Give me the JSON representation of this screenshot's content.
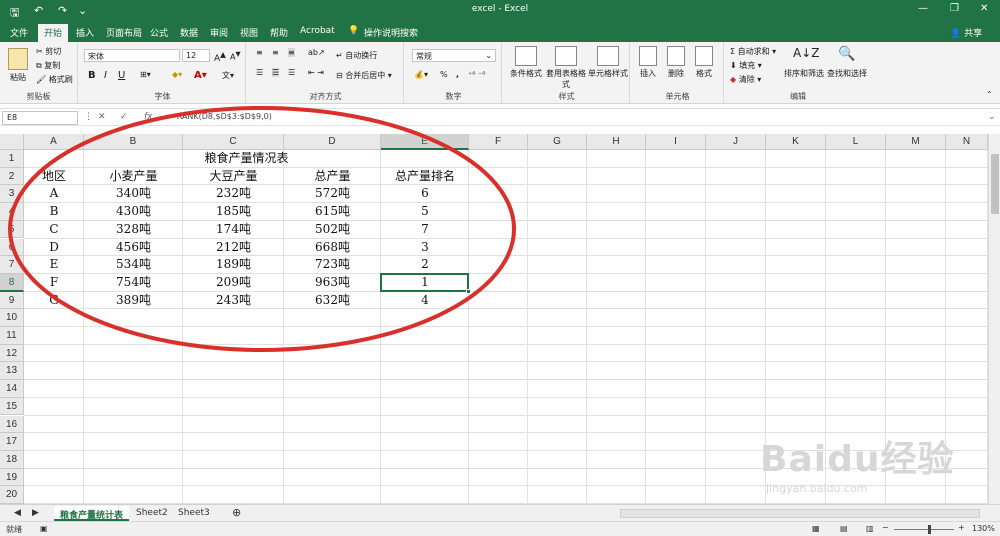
{
  "window": {
    "title": "excel - Excel",
    "account": "共享",
    "caption_min": "—",
    "caption_restore": "❐",
    "caption_close": "✕"
  },
  "ribbon_tabs": [
    "文件",
    "开始",
    "插入",
    "页面布局",
    "公式",
    "数据",
    "审阅",
    "视图",
    "帮助",
    "Acrobat",
    "操作说明搜索"
  ],
  "active_tab": "开始",
  "ribbon": {
    "clipboard": {
      "label": "剪贴板",
      "paste": "粘贴",
      "cut": "剪切",
      "copy": "复制",
      "format_painter": "格式刷"
    },
    "font": {
      "label": "字体",
      "font_name": "宋体",
      "font_size": "12",
      "bold": "B",
      "italic": "I",
      "underline": "U"
    },
    "alignment": {
      "label": "对齐方式",
      "wrap": "自动换行",
      "merge": "合并后居中"
    },
    "number": {
      "label": "数字",
      "format": "常规",
      "percent": "%",
      "comma": ","
    },
    "styles": {
      "label": "样式",
      "conditional": "条件格式",
      "table": "套用表格格式",
      "cell_styles": "单元格样式"
    },
    "cells": {
      "label": "单元格",
      "insert": "插入",
      "delete": "删除",
      "format": "格式"
    },
    "editing": {
      "label": "编辑",
      "autosum": "自动求和",
      "fill": "填充",
      "clear": "清除",
      "sort": "排序和筛选",
      "find": "查找和选择"
    }
  },
  "formula_bar": {
    "name_box": "E8",
    "formula": "=RANK(D8,$D$3:$D$9,0)"
  },
  "columns": [
    "A",
    "B",
    "C",
    "D",
    "E",
    "F",
    "G",
    "H",
    "I",
    "J",
    "K",
    "L",
    "M",
    "N"
  ],
  "rows": [
    "1",
    "2",
    "3",
    "4",
    "5",
    "6",
    "7",
    "8",
    "9",
    "10",
    "11",
    "12",
    "13",
    "14",
    "15",
    "16",
    "17",
    "18",
    "19",
    "20"
  ],
  "sheet": {
    "title": "粮食产量情况表",
    "headers": [
      "地区",
      "小麦产量",
      "大豆产量",
      "总产量",
      "总产量排名"
    ],
    "data": [
      [
        "A",
        "340吨",
        "232吨",
        "572吨",
        "6"
      ],
      [
        "B",
        "430吨",
        "185吨",
        "615吨",
        "5"
      ],
      [
        "C",
        "328吨",
        "174吨",
        "502吨",
        "7"
      ],
      [
        "D",
        "456吨",
        "212吨",
        "668吨",
        "3"
      ],
      [
        "E",
        "534吨",
        "189吨",
        "723吨",
        "2"
      ],
      [
        "F",
        "754吨",
        "209吨",
        "963吨",
        "1"
      ],
      [
        "G",
        "389吨",
        "243吨",
        "632吨",
        "4"
      ]
    ],
    "selected_cell": "E8"
  },
  "sheet_tabs": [
    "粮食产量统计表",
    "Sheet2",
    "Sheet3"
  ],
  "active_sheet": "粮食产量统计表",
  "status": {
    "ready": "就绪",
    "zoom": "130%"
  },
  "watermark": {
    "brand": "Baidu经验",
    "url": "jingyan.baidu.com"
  },
  "colors": {
    "excel_green": "#217346",
    "annotation_red": "#d9302c"
  }
}
